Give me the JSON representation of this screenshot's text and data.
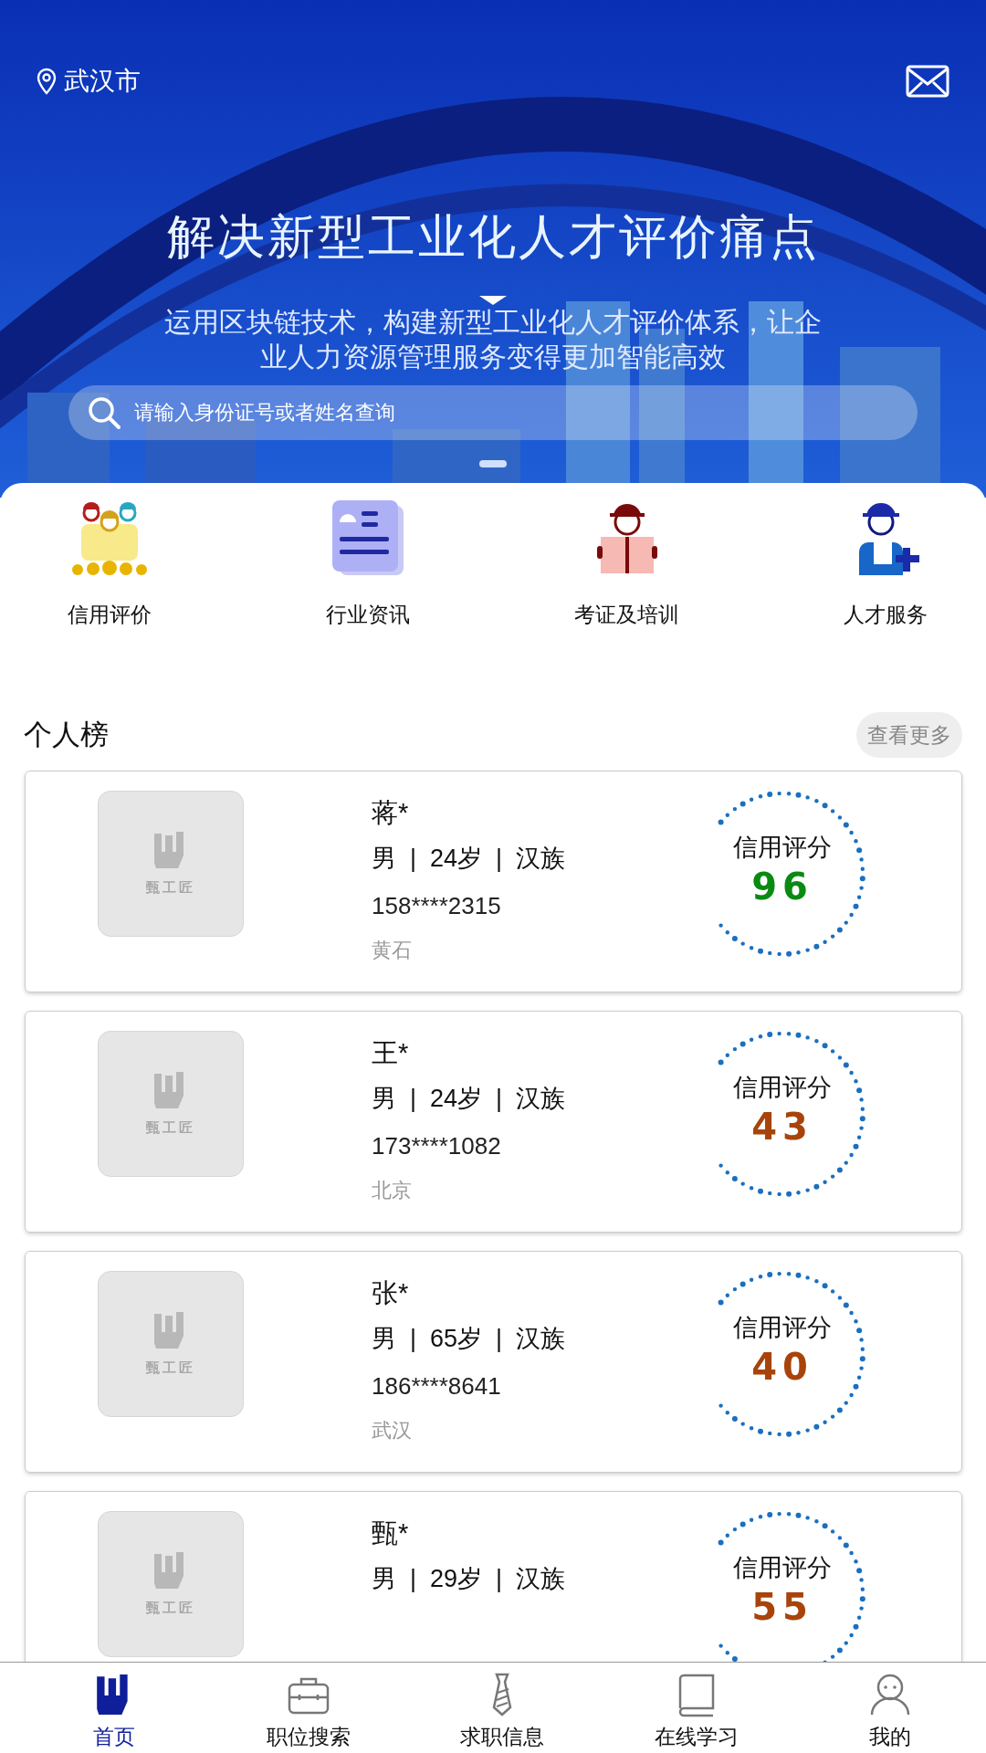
{
  "banner": {
    "kind": "picture",
    "location": "武汉市",
    "headline": "解决新型工业化人才评价痛点",
    "subtitle_lines": [
      "运用区块链技术，构建新型工业化人才评价体系，让企",
      "业人力资源管理服务变得更加智能高效"
    ],
    "search": {
      "placeholder": "请输入身份证号或者姓名查询"
    }
  },
  "shortcuts": [
    {
      "kind": "workers",
      "label": "信用评价"
    },
    {
      "kind": "news",
      "label": "行业资讯"
    },
    {
      "kind": "reader",
      "label": "考证及培训"
    },
    {
      "kind": "worker",
      "label": "人才服务"
    }
  ],
  "ranking": {
    "title": "个人榜",
    "more": "查看更多",
    "items": [
      {
        "avatar_label": "甄工匠",
        "name": "蒋*",
        "details": "男  |  24岁  |  汉族",
        "phone": "158****2315",
        "city": "黄石",
        "score_label": "信用评分",
        "score": "96",
        "color": "#0b8a12"
      },
      {
        "avatar_label": "甄工匠",
        "name": "王*",
        "details": "男  |  24岁  |  汉族",
        "phone": "173****1082",
        "city": "北京",
        "score_label": "信用评分",
        "score": "43",
        "color": "#a8440a"
      },
      {
        "avatar_label": "甄工匠",
        "name": "张*",
        "details": "男  |  65岁  |  汉族",
        "phone": "186****8641",
        "city": "武汉",
        "score_label": "信用评分",
        "score": "40",
        "color": "#a8440a"
      },
      {
        "avatar_label": "甄工匠",
        "name": "甄*",
        "details": "男  |  29岁  |  汉族",
        "score_label": "信用评分",
        "score": "55",
        "color": "#a8440a"
      }
    ]
  },
  "tabbar": [
    {
      "kind": "home",
      "label": "首页",
      "selected": true
    },
    {
      "kind": "briefcase",
      "label": "职位搜索",
      "selected": false
    },
    {
      "kind": "tie",
      "label": "求职信息",
      "selected": false
    },
    {
      "kind": "book",
      "label": "在线学习",
      "selected": false
    },
    {
      "kind": "person",
      "label": "我的",
      "selected": false
    }
  ]
}
